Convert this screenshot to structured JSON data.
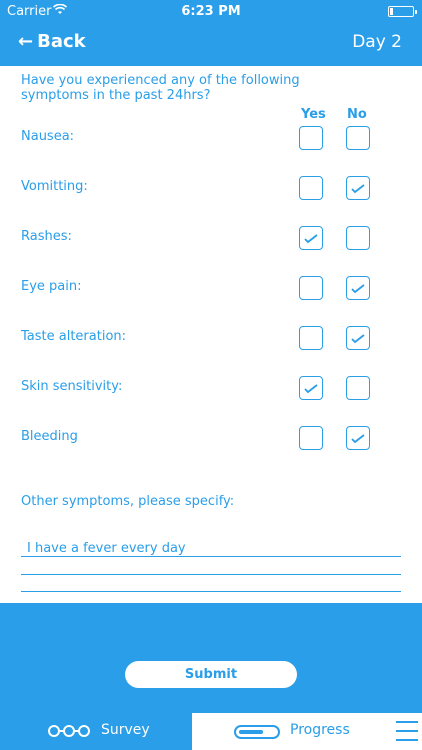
{
  "status": {
    "carrier": "Carrier",
    "time": "6:23 PM",
    "battery_level": 0.15
  },
  "nav": {
    "back_label": "Back",
    "day_label": "Day 2"
  },
  "survey": {
    "question": "Have you experienced any of the following symptoms in the past 24hrs?",
    "yes_label": "Yes",
    "no_label": "No",
    "symptoms": [
      {
        "label": "Nausea:",
        "answer": null
      },
      {
        "label": "Vomitting:",
        "answer": "no"
      },
      {
        "label": "Rashes:",
        "answer": "yes"
      },
      {
        "label": "Eye pain:",
        "answer": "no"
      },
      {
        "label": "Taste alteration:",
        "answer": "no"
      },
      {
        "label": "Skin sensitivity:",
        "answer": "yes"
      },
      {
        "label": "Bleeding",
        "answer": "no"
      }
    ],
    "other_label": "Other symptoms, please specify:",
    "other_value": "I have a fever every day"
  },
  "submit_label": "Submit",
  "tabs": {
    "survey_label": "Survey",
    "progress_label": "Progress"
  },
  "colors": {
    "accent": "#2a9ee8",
    "background": "#ffffff"
  }
}
